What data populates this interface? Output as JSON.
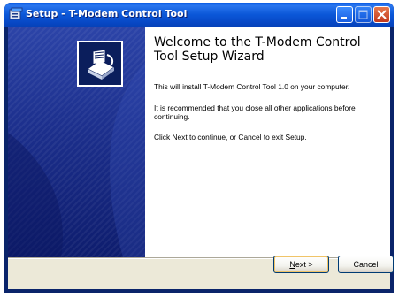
{
  "window": {
    "title": "Setup - T-Modem Control Tool",
    "controls": {
      "minimize": "minimize",
      "maximize": "maximize",
      "close": "close"
    }
  },
  "wizard": {
    "heading": "Welcome to the T-Modem Control Tool Setup Wizard",
    "paragraphs": [
      "This will install T-Modem Control Tool 1.0 on your computer.",
      "It is recommended that you close all other applications before continuing.",
      "Click Next to continue, or Cancel to exit Setup."
    ]
  },
  "buttons": {
    "next_first": "N",
    "next_rest": "ext >",
    "cancel": "Cancel"
  },
  "icons": {
    "title": "setup-installer-icon",
    "side_logo": "installer-box-icon"
  },
  "colors": {
    "titlebar": "#0a5ce5",
    "side_panel": "#1c2f8c",
    "client": "#ece9d8",
    "close_button": "#c2381c"
  }
}
